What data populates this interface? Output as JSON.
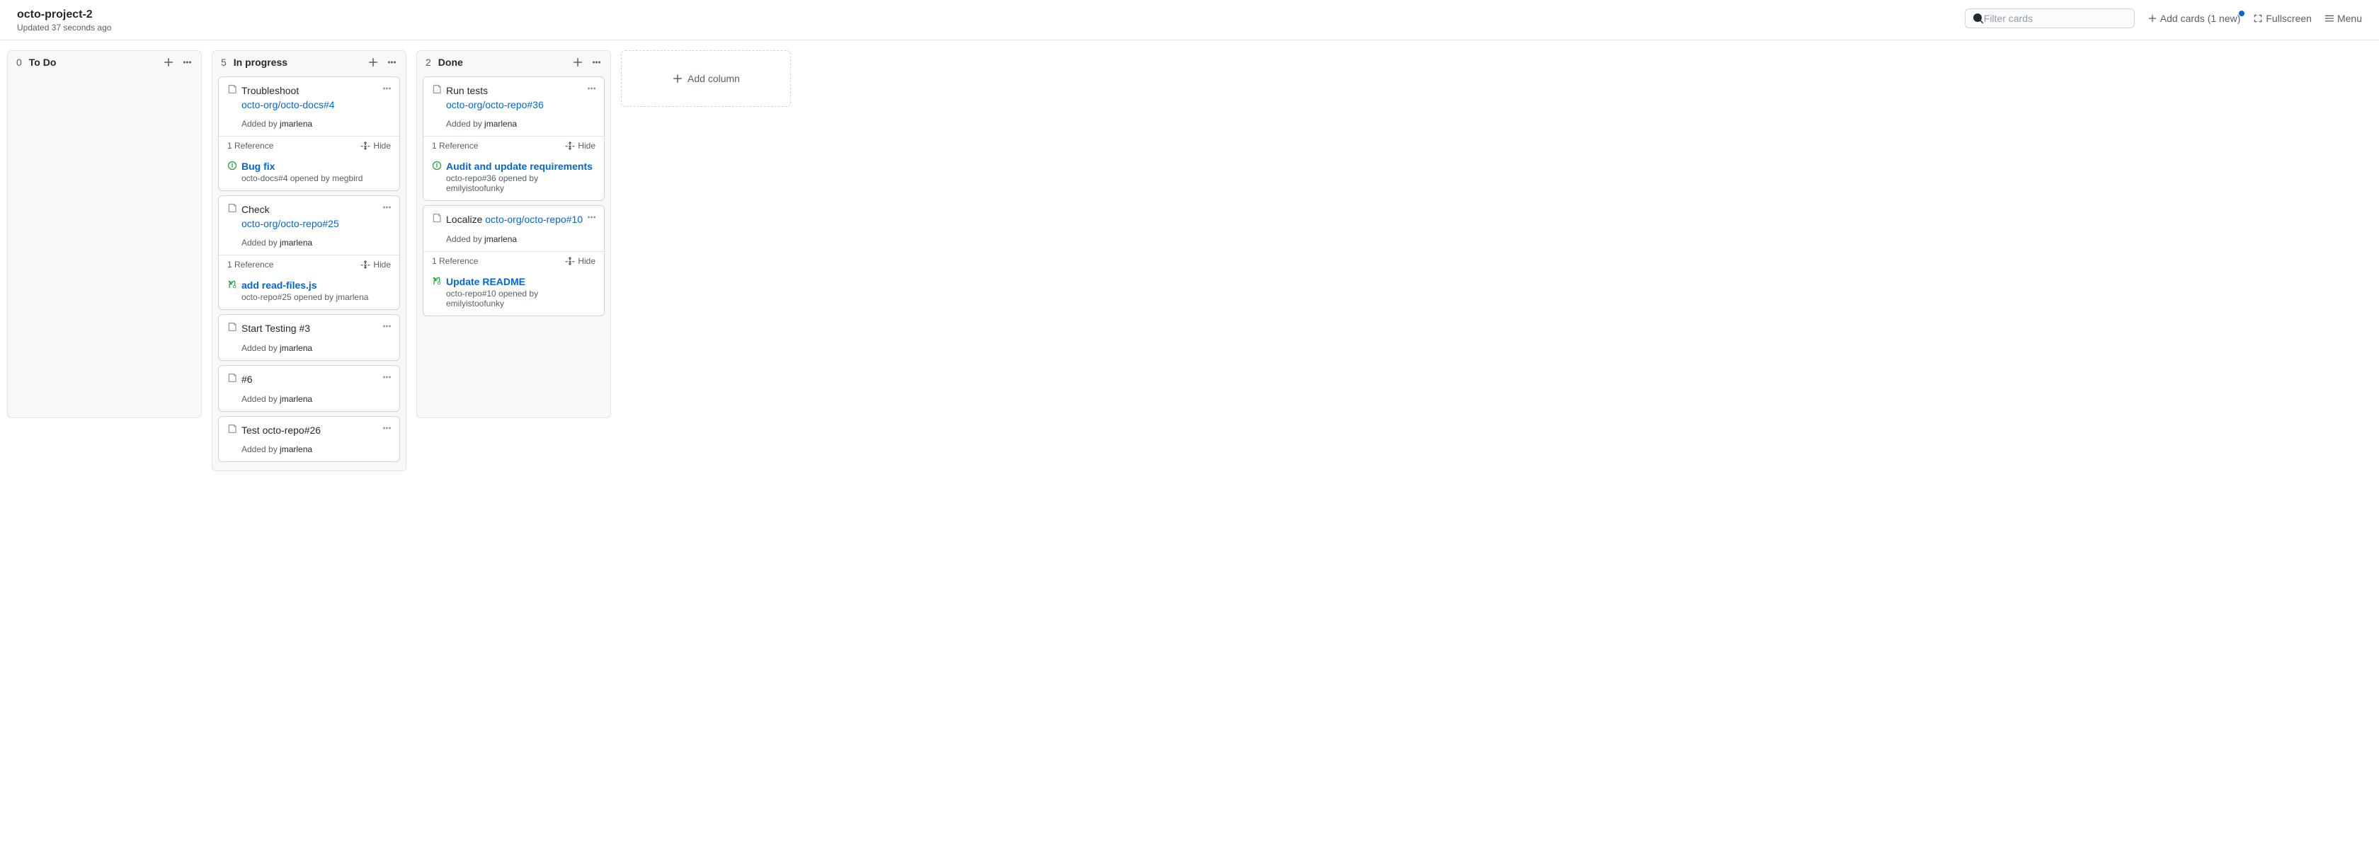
{
  "header": {
    "title": "octo-project-2",
    "updated": "Updated 37 seconds ago",
    "search_placeholder": "Filter cards",
    "add_cards_label": "Add cards (1 new)",
    "fullscreen_label": "Fullscreen",
    "menu_label": "Menu"
  },
  "add_column_label": "Add column",
  "ref_label_1": "1 Reference",
  "hide_label": "Hide",
  "added_by_prefix": "Added by ",
  "opened_by_joiner": " opened by ",
  "columns": [
    {
      "count": "0",
      "title": "To Do",
      "cards": []
    },
    {
      "count": "5",
      "title": "In progress",
      "cards": [
        {
          "title_text": "Troubleshoot ",
          "title_link": "octo-org/octo-docs#4",
          "added_by": "jmarlena",
          "reference": {
            "kind": "issue",
            "title": "Bug fix",
            "sub_prefix": "octo-docs#4",
            "opened_by": "megbird"
          }
        },
        {
          "title_text": "Check ",
          "title_link": "octo-org/octo-repo#25",
          "added_by": "jmarlena",
          "reference": {
            "kind": "pr",
            "title": "add read-files.js",
            "sub_prefix": "octo-repo#25",
            "opened_by": "jmarlena"
          }
        },
        {
          "title_text": "Start Testing #3",
          "added_by": "jmarlena"
        },
        {
          "title_text": "#6",
          "added_by": "jmarlena"
        },
        {
          "title_text": "Test octo-repo#26",
          "added_by": "jmarlena"
        }
      ]
    },
    {
      "count": "2",
      "title": "Done",
      "cards": [
        {
          "title_text": "Run tests ",
          "title_link": "octo-org/octo-repo#36",
          "added_by": "jmarlena",
          "reference": {
            "kind": "issue",
            "title": "Audit and update requirements",
            "sub_prefix": "octo-repo#36",
            "opened_by": "emilyistoofunky"
          }
        },
        {
          "title_text": "Localize ",
          "title_link": "octo-org/octo-repo#10",
          "title_link_inline": true,
          "added_by": "jmarlena",
          "reference": {
            "kind": "pr",
            "title": "Update README",
            "sub_prefix": "octo-repo#10",
            "opened_by": "emilyistoofunky"
          }
        }
      ]
    }
  ]
}
